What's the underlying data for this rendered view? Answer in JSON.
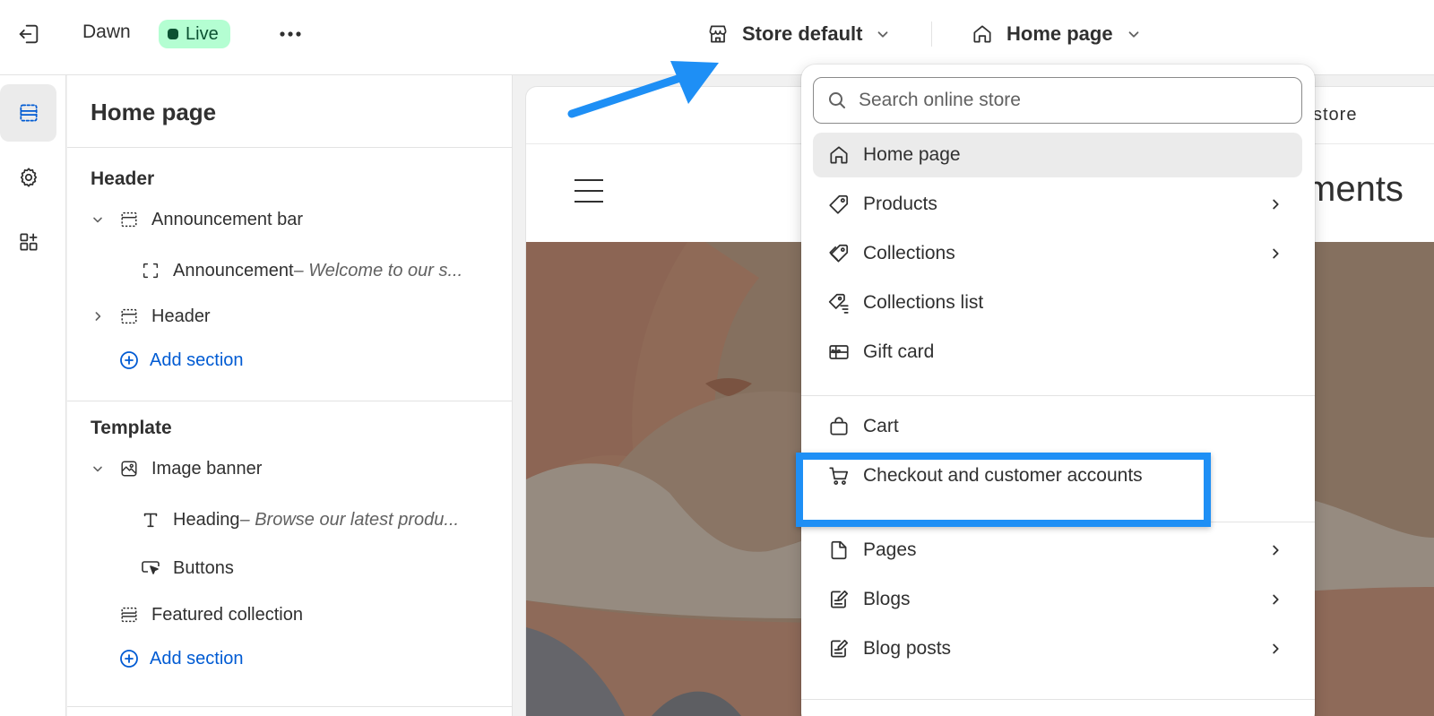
{
  "topbar": {
    "theme_name": "Dawn",
    "live_badge": "Live",
    "store_select": "Store default",
    "page_select": "Home page"
  },
  "sidebar": {
    "title": "Home page",
    "header_group": "Header",
    "header_rows": [
      {
        "label": "Announcement bar"
      },
      {
        "label": "Announcement",
        "sub": " – Welcome to our s..."
      },
      {
        "label": "Header"
      },
      {
        "label": "Add section"
      }
    ],
    "template_group": "Template",
    "template_rows": [
      {
        "label": "Image banner"
      },
      {
        "label": "Heading",
        "sub": " – Browse our latest produ..."
      },
      {
        "label": "Buttons"
      },
      {
        "label": "Featured collection"
      },
      {
        "label": "Add section"
      }
    ]
  },
  "preview": {
    "announcement_text": "store",
    "logo_text": "ments"
  },
  "dropdown": {
    "search_placeholder": "Search online store",
    "items": [
      {
        "label": "Home page",
        "icon": "home-icon",
        "selected": true
      },
      {
        "label": "Products",
        "icon": "tag-icon",
        "has_submenu": true
      },
      {
        "label": "Collections",
        "icon": "collection-icon",
        "has_submenu": true
      },
      {
        "label": "Collections list",
        "icon": "collection-list-icon"
      },
      {
        "label": "Gift card",
        "icon": "gift-card-icon"
      },
      {
        "label": "Cart",
        "icon": "bag-icon"
      },
      {
        "label": "Checkout and customer accounts",
        "icon": "cart-icon",
        "highlighted": true
      },
      {
        "label": "Pages",
        "icon": "page-icon",
        "has_submenu": true
      },
      {
        "label": "Blogs",
        "icon": "blog-icon",
        "has_submenu": true
      },
      {
        "label": "Blog posts",
        "icon": "blog-post-icon",
        "has_submenu": true
      }
    ]
  },
  "colors": {
    "accent_link": "#005bd3",
    "annotation_blue": "#1e8ff5",
    "live_green": "#b4fed2"
  }
}
